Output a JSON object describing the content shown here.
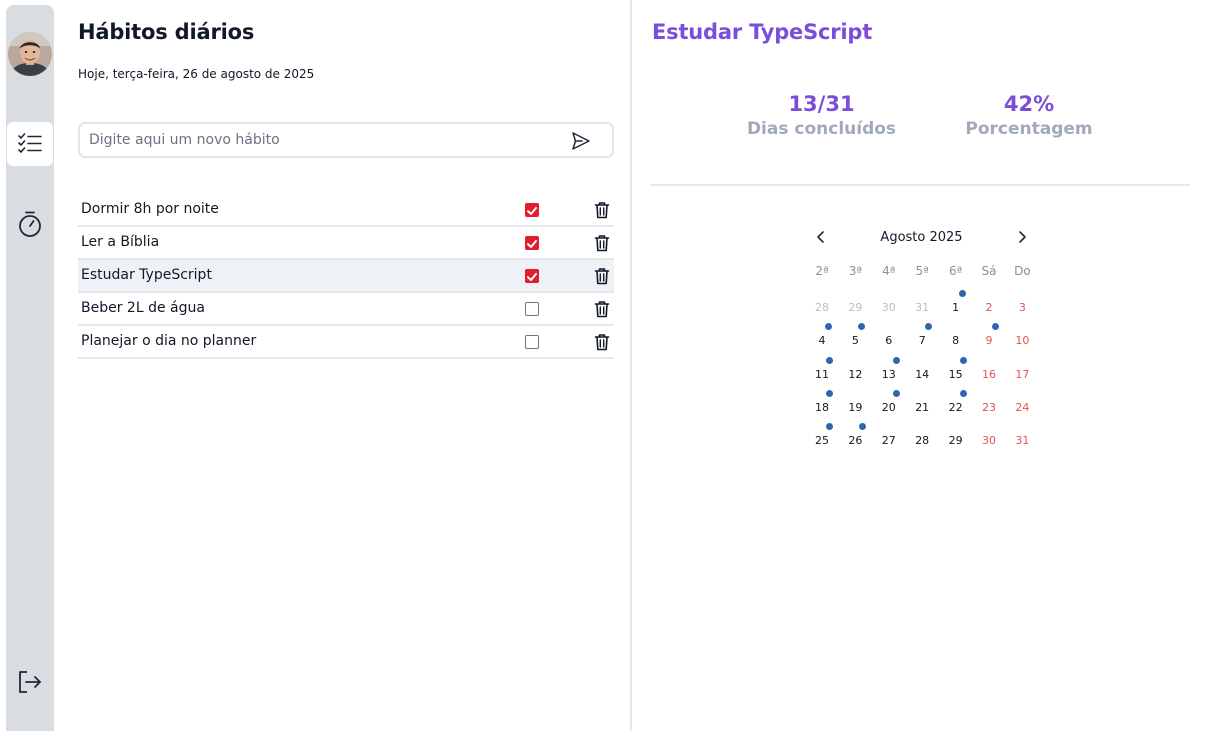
{
  "header": {
    "title": "Hábitos diários",
    "date": "Hoje, terça-feira, 26 de agosto de 2025"
  },
  "sidebar": {
    "items": [
      {
        "icon": "avatar"
      },
      {
        "icon": "checklist-icon",
        "active": true
      },
      {
        "icon": "timer-icon"
      },
      {
        "icon": "logout-icon"
      }
    ]
  },
  "new_habit": {
    "placeholder": "Digite aqui um novo hábito",
    "value": ""
  },
  "habits": [
    {
      "name": "Dormir 8h por noite",
      "done": true
    },
    {
      "name": "Ler a Bíblia",
      "done": true
    },
    {
      "name": "Estudar TypeScript",
      "done": true,
      "selected": true
    },
    {
      "name": "Beber 2L de água",
      "done": false
    },
    {
      "name": "Planejar o dia no planner",
      "done": false
    }
  ],
  "detail": {
    "title": "Estudar TypeScript",
    "days_value": "13/31",
    "days_label": "Dias concluídos",
    "percent_value": "42%",
    "percent_label": "Porcentagem"
  },
  "calendar": {
    "month_label": "Agosto 2025",
    "weekdays": [
      "2ª",
      "3ª",
      "4ª",
      "5ª",
      "6ª",
      "Sá",
      "Do"
    ],
    "weeks": [
      [
        {
          "d": "28",
          "out": true
        },
        {
          "d": "29",
          "out": true
        },
        {
          "d": "30",
          "out": true
        },
        {
          "d": "31",
          "out": true
        },
        {
          "d": "1",
          "done": true
        },
        {
          "d": "2"
        },
        {
          "d": "3"
        }
      ],
      [
        {
          "d": "4",
          "done": true
        },
        {
          "d": "5",
          "done": true
        },
        {
          "d": "6"
        },
        {
          "d": "7",
          "done": true
        },
        {
          "d": "8"
        },
        {
          "d": "9",
          "done": true
        },
        {
          "d": "10"
        }
      ],
      [
        {
          "d": "11",
          "done": true
        },
        {
          "d": "12"
        },
        {
          "d": "13",
          "done": true
        },
        {
          "d": "14"
        },
        {
          "d": "15",
          "done": true
        },
        {
          "d": "16"
        },
        {
          "d": "17"
        }
      ],
      [
        {
          "d": "18",
          "done": true
        },
        {
          "d": "19"
        },
        {
          "d": "20",
          "done": true
        },
        {
          "d": "21"
        },
        {
          "d": "22",
          "done": true
        },
        {
          "d": "23"
        },
        {
          "d": "24"
        }
      ],
      [
        {
          "d": "25",
          "done": true
        },
        {
          "d": "26",
          "done": true
        },
        {
          "d": "27"
        },
        {
          "d": "28"
        },
        {
          "d": "29"
        },
        {
          "d": "30"
        },
        {
          "d": "31"
        }
      ]
    ]
  },
  "colors": {
    "accent": "#7c4ddb",
    "check": "#e11d2e",
    "dot": "#2f67ad",
    "weekend": "#e05555",
    "muted": "#a0aab9"
  }
}
